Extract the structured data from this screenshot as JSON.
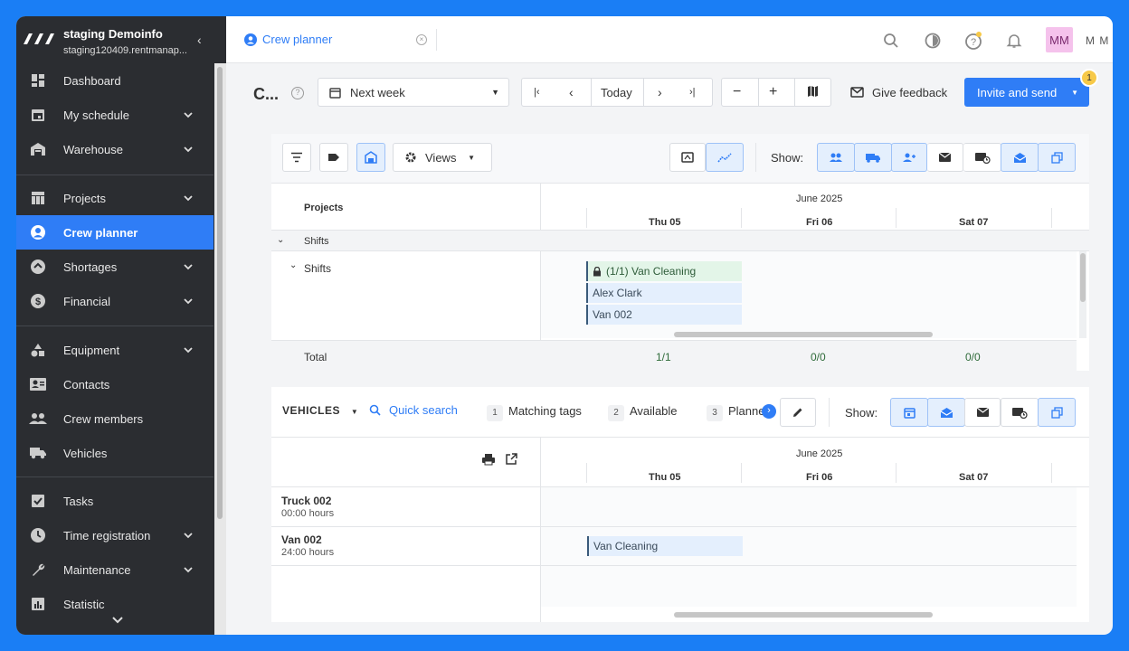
{
  "org": {
    "name": "staging Demoinfo",
    "url": "staging120409.rentmanap..."
  },
  "nav": [
    {
      "label": "Dashboard",
      "icon": "dashboard-icon",
      "chevron": false
    },
    {
      "label": "My schedule",
      "icon": "calendar-icon",
      "chevron": true
    },
    {
      "label": "Warehouse",
      "icon": "warehouse-icon",
      "chevron": true
    },
    {
      "label": "Projects",
      "icon": "table-icon",
      "chevron": true
    },
    {
      "label": "Crew planner",
      "icon": "person-icon",
      "chevron": false,
      "active": true
    },
    {
      "label": "Shortages",
      "icon": "shortage-icon",
      "chevron": true
    },
    {
      "label": "Financial",
      "icon": "dollar-icon",
      "chevron": true
    },
    {
      "label": "Equipment",
      "icon": "shapes-icon",
      "chevron": true
    },
    {
      "label": "Contacts",
      "icon": "contact-card-icon",
      "chevron": false
    },
    {
      "label": "Crew members",
      "icon": "group-icon",
      "chevron": false
    },
    {
      "label": "Vehicles",
      "icon": "truck-icon",
      "chevron": false
    },
    {
      "label": "Tasks",
      "icon": "checkbox-icon",
      "chevron": false
    },
    {
      "label": "Time registration",
      "icon": "clock-icon",
      "chevron": true
    },
    {
      "label": "Maintenance",
      "icon": "wrench-icon",
      "chevron": true
    },
    {
      "label": "Statistic",
      "icon": "bar-chart-icon",
      "chevron": false
    }
  ],
  "topbar": {
    "tab_label": "Crew planner",
    "user_initials_avatar": "MM",
    "user_initials": "M M"
  },
  "toolbar": {
    "page_title": "C...",
    "period": "Next week",
    "today": "Today",
    "feedback": "Give feedback",
    "invite": "Invite and send",
    "badge": "1"
  },
  "upper": {
    "views": "Views",
    "show": "Show:",
    "month": "June 2025",
    "days": [
      "Thu 05",
      "Fri 06",
      "Sat 07"
    ],
    "col_header": "Projects",
    "group": "Shifts",
    "subgroup": "Shifts",
    "events": [
      "(1/1) Van Cleaning",
      "Alex Clark",
      "Van 002"
    ],
    "total_label": "Total",
    "totals": [
      "1/1",
      "0/0",
      "0/0"
    ]
  },
  "lower": {
    "resource": "VEHICLES",
    "quick_search": "Quick search",
    "tags": [
      {
        "num": "1",
        "label": "Matching tags"
      },
      {
        "num": "2",
        "label": "Available"
      },
      {
        "num": "3",
        "label": "Planne"
      }
    ],
    "show": "Show:",
    "month": "June 2025",
    "days": [
      "Thu 05",
      "Fri 06",
      "Sat 07"
    ],
    "rows": [
      {
        "name": "Truck 002",
        "hours": "00:00 hours"
      },
      {
        "name": "Van 002",
        "hours": "24:00 hours"
      }
    ],
    "event": "Van Cleaning"
  },
  "colors": {
    "accent": "#2f7df6",
    "sidebar": "#2b2d31",
    "background": "#1a7ef5"
  }
}
